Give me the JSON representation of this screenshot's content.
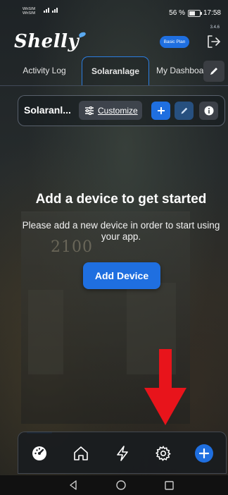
{
  "status_bar": {
    "carrier_line1": "WhSIM",
    "carrier_line2": "WhSIM",
    "battery_percent": "56 %",
    "time": "17:58"
  },
  "header": {
    "logo": "Shelly",
    "version": "3.4.6",
    "plan_badge": "Basic Plan",
    "logout_icon": "logout-icon"
  },
  "tabs": [
    {
      "label": "Activity Log",
      "active": false
    },
    {
      "label": "Solaranlage",
      "active": true
    },
    {
      "label": "My Dashboard",
      "active": false
    }
  ],
  "room_bar": {
    "name": "Solaranl...",
    "customize_label": "Customize"
  },
  "empty_state": {
    "title": "Add a device to get started",
    "message": "Please add a new device in order to start using your app.",
    "button": "Add Device"
  },
  "background": {
    "house_number": "2100"
  },
  "bottom_nav": {
    "items": [
      "dashboard-icon",
      "home-icon",
      "energy-icon",
      "settings-icon",
      "add-icon"
    ],
    "active_index": 0
  },
  "colors": {
    "accent": "#1f6fe0",
    "arrow": "#e8141b"
  }
}
